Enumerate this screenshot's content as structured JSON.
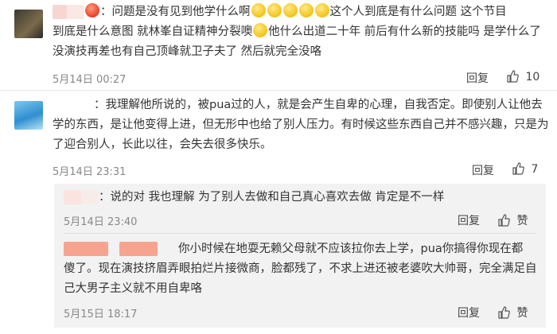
{
  "comments": [
    {
      "text_part1": "：问题是没有见到他学什么啊",
      "text_part2": "这个人到底是有什么问题 这个节目",
      "text_line2a": "到底是什么意图 就林峯自证精神分裂噢",
      "text_line2b": "他什么出道二十年 前后有什么新的技能吗 是学什么了",
      "text_line3": "没演技再差也有自己顶峰就卫子夫了 然后就完全没咯",
      "time": "5月14日 00:27",
      "reply_label": "回复",
      "like_count": "10"
    },
    {
      "line1": "：我理解他所说的，被pua过的人，就是会产生自卑的心理，自我否定。即使别人让他去",
      "line2": "学的东西，是让他变得上进，但无形中也给了别人压力。有时候这些东西自己并不感兴趣，只是为",
      "line3": "了迎合别人，长此以往，会失去很多快乐。",
      "time": "5月14日 23:31",
      "reply_label": "回复",
      "like_count": "7"
    }
  ],
  "replies": [
    {
      "line1": "：说的对 我也理解 为了别人去做和自己真心喜欢去做 肯定是不一样",
      "time": "5月14日 23:40",
      "reply_label": "回复",
      "like_label": "赞"
    },
    {
      "line1": "你小时候在地耍无赖父母就不应该拉你去上学，pua你搞得你现在都",
      "line2": "傻了。现在演技挤眉弄眼拍烂片接微商，脸都残了，不求上进还被老婆吹大帅哥，完全满足自",
      "line3": "己大男子主义就不用自卑咯",
      "time": "5月15日 18:17",
      "reply_label": "回复",
      "like_label": "赞"
    }
  ]
}
